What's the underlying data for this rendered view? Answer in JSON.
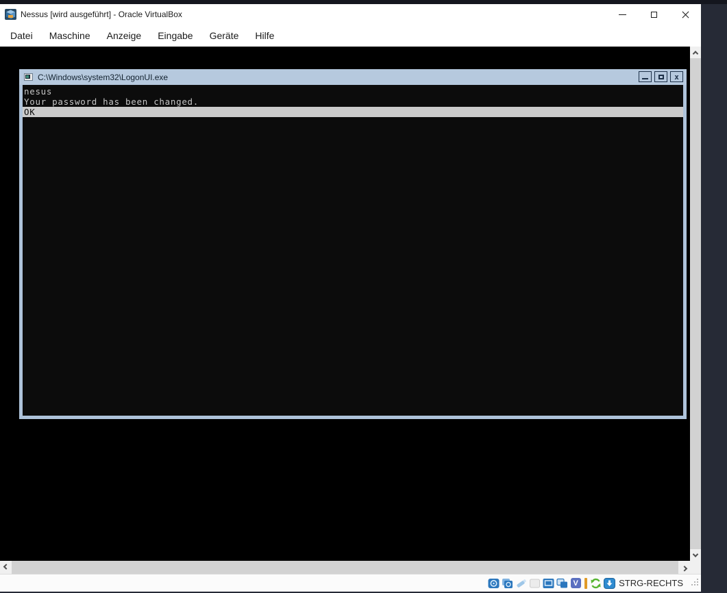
{
  "window": {
    "title": "Nessus [wird ausgeführt] - Oracle VirtualBox",
    "controls": {
      "minimize": "minimize",
      "maximize": "maximize",
      "close": "close"
    }
  },
  "menubar": {
    "items": [
      {
        "label": "Datei"
      },
      {
        "label": "Maschine"
      },
      {
        "label": "Anzeige"
      },
      {
        "label": "Eingabe"
      },
      {
        "label": "Geräte"
      },
      {
        "label": "Hilfe"
      }
    ]
  },
  "console_window": {
    "title": "C:\\Windows\\system32\\LogonUI.exe",
    "controls": {
      "minimize": "minimize",
      "maximize": "maximize",
      "close": "close"
    },
    "close_glyph": "x",
    "lines": [
      {
        "text": "nesus",
        "highlighted": false
      },
      {
        "text": "Your password has been changed.",
        "highlighted": false
      },
      {
        "text": "OK",
        "highlighted": true
      }
    ]
  },
  "statusbar": {
    "icons": [
      "hard-disk",
      "optical-drive",
      "usb",
      "network",
      "display",
      "shared-folders",
      "features",
      "recording-indicator",
      "mouse-integration",
      "keyboard-capture"
    ],
    "features_glyph": "V",
    "host_key_label": "STRG-RECHTS"
  },
  "colors": {
    "desktop": "#262a36",
    "titlebar_bg": "#ffffff",
    "vm_display_bg": "#000000",
    "console_titlebar": "#b6c9de",
    "console_border": "#aec3da",
    "console_text": "#c6c6c6",
    "console_highlight_bg": "#cbcbcb",
    "status_accent_blue": "#2b77bd",
    "features_purple": "#5a6fc0",
    "recording_amber": "#e09a28",
    "mouse_green": "#57b531"
  }
}
